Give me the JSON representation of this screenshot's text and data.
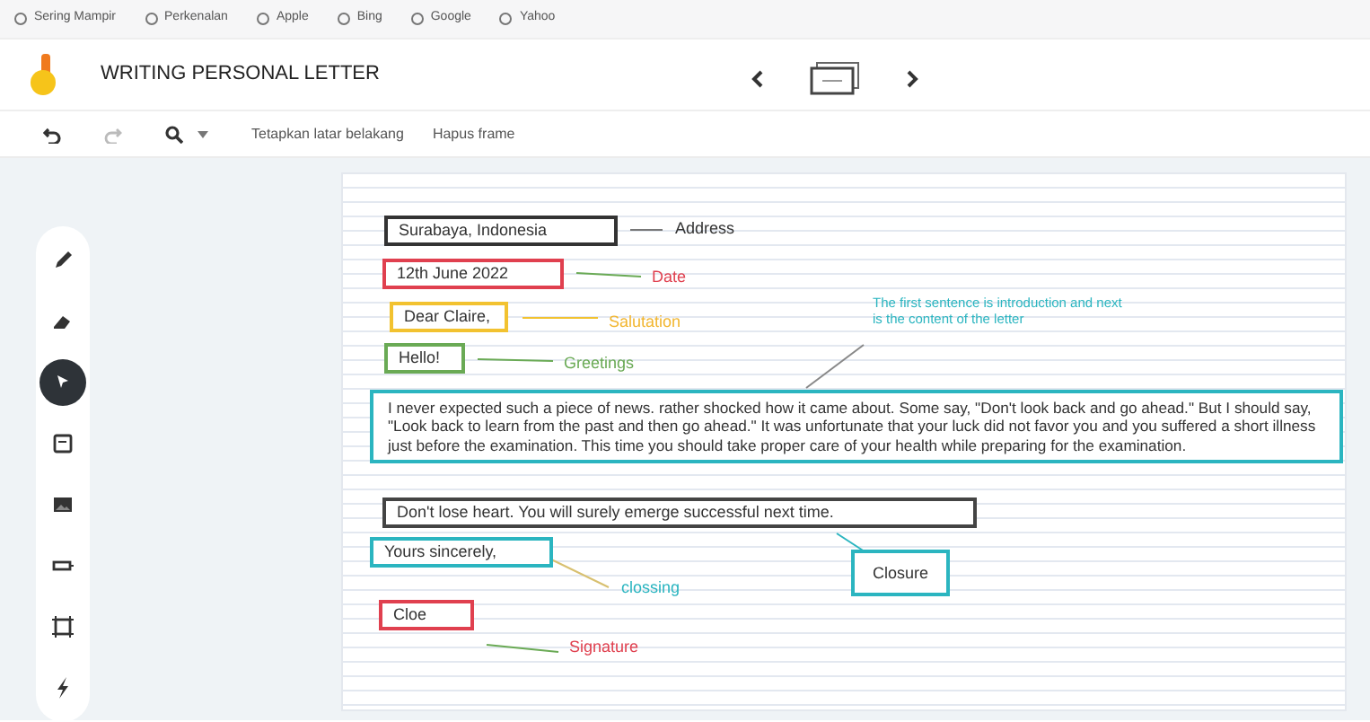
{
  "bookmarks": [
    {
      "label": "Sering Mampir"
    },
    {
      "label": "Perkenalan"
    },
    {
      "label": "Apple"
    },
    {
      "label": "Bing"
    },
    {
      "label": "Google"
    },
    {
      "label": "Yahoo"
    }
  ],
  "app": {
    "title": "WRITING PERSONAL LETTER"
  },
  "toolbar": {
    "actions": [
      "Tetapkan latar belakang",
      "Hapus frame"
    ]
  },
  "tools": [
    {
      "kind": "pen",
      "selected": false
    },
    {
      "kind": "eraser",
      "selected": false
    },
    {
      "kind": "select",
      "selected": true
    },
    {
      "kind": "note",
      "selected": false
    },
    {
      "kind": "image",
      "selected": false
    },
    {
      "kind": "shape",
      "selected": false
    },
    {
      "kind": "frame",
      "selected": false
    },
    {
      "kind": "laser",
      "selected": false
    }
  ],
  "letter_boxes": [
    {
      "text": "Surabaya, Indonesia",
      "color": "#333333"
    },
    {
      "text": "12th June 2022",
      "color": "#e0404f"
    },
    {
      "text": "Dear Claire,",
      "color": "#f2c230"
    },
    {
      "text": "Hello!",
      "color": "#6aaa55"
    },
    {
      "text": "I never expected such a piece of news. rather shocked how it came about. Some say, \"Don't look back and go ahead.\" But I should say, \"Look back to learn from the past and then go ahead.\" It was unfortunate that your luck did not favor you and you suffered a short illness just before the examination. This time you should take proper care of your health while preparing for the examination.",
      "color": "#2bb5c0"
    },
    {
      "text": "Don't lose heart. You will surely emerge successful next time.",
      "color": "#444444"
    },
    {
      "text": "Yours sincerely,",
      "color": "#2bb5c0"
    },
    {
      "text": "Cloe",
      "color": "#e0404f"
    }
  ],
  "labels": [
    {
      "text": "Address",
      "color": "#333333",
      "kind": "plain"
    },
    {
      "text": "Date",
      "color": "#e0404f",
      "kind": "plain"
    },
    {
      "text": "Salutation",
      "color": "#f2b630",
      "kind": "plain"
    },
    {
      "text": "Greetings",
      "color": "#6aaa55",
      "kind": "plain"
    },
    {
      "text": "The first sentence is introduction and next is the  content of the letter",
      "color": "#2bb5c0",
      "kind": "plain"
    },
    {
      "text": "clossing",
      "color": "#2bb5c0",
      "kind": "plain"
    },
    {
      "text": "Closure",
      "color": "#2bb5c0",
      "kind": "boxed"
    },
    {
      "text": "Signature",
      "color": "#e0404f",
      "kind": "plain"
    }
  ]
}
